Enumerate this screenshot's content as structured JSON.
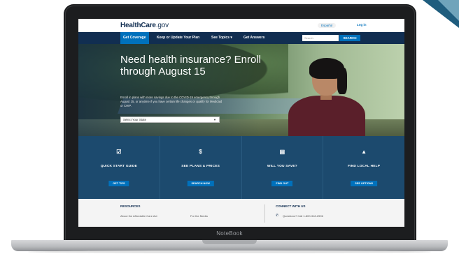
{
  "site": {
    "logo_main": "HealthCare",
    "logo_suffix": ".gov",
    "espanol": "Español",
    "login": "Log in"
  },
  "nav": {
    "items": [
      {
        "label": "Get Coverage"
      },
      {
        "label": "Keep or Update Your Plan"
      },
      {
        "label": "See Topics ▾"
      },
      {
        "label": "Get Answers"
      }
    ],
    "search_placeholder": "Search",
    "search_button": "SEARCH"
  },
  "hero": {
    "title": "Need health insurance? Enroll through August 15",
    "text": "Enroll in plans with more savings due to the COVID-19 emergency through August 15, or anytime if you have certain life changes or qualify for Medicaid or CHIP.",
    "state_select": "Select Your State"
  },
  "cards": [
    {
      "icon": "☑",
      "icon_name": "checklist-icon",
      "title": "QUICK START GUIDE",
      "button": "GET TIPS"
    },
    {
      "icon": "$",
      "icon_name": "dollar-icon",
      "title": "SEE PLANS & PRICES",
      "button": "SEARCH NOW"
    },
    {
      "icon": "▤",
      "icon_name": "calculator-icon",
      "title": "WILL YOU SAVE?",
      "button": "FIND OUT"
    },
    {
      "icon": "▲",
      "icon_name": "road-icon",
      "title": "FIND LOCAL HELP",
      "button": "SEE OPTIONS"
    }
  ],
  "footer": {
    "resources_title": "RESOURCES",
    "link_1": "About the Affordable Care Act",
    "link_2": "For the Media",
    "connect_title": "CONNECT WITH US",
    "phone": "Questions? Call 1-800-318-2596"
  },
  "device_label": "NoteBook",
  "colors": {
    "navy": "#112e51",
    "accent_blue": "#0071bc",
    "card_panel": "#1c4a6e"
  }
}
